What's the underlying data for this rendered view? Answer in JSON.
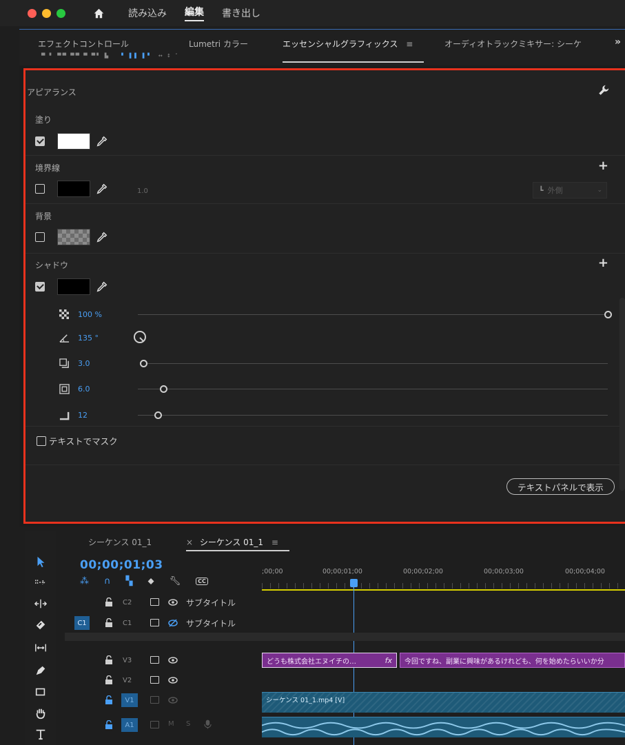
{
  "app": {
    "traffic_colors": [
      "#ff5f57",
      "#febc2e",
      "#28c840"
    ],
    "workspaces": [
      "読み込み",
      "編集",
      "書き出し"
    ],
    "active_workspace": "編集"
  },
  "panel_tabs": {
    "effect_controls": "エフェクトコントロール",
    "lumetri": "Lumetri カラー",
    "essential_graphics": "エッセンシャルグラフィックス",
    "essential_menu": "≡",
    "audio_mixer": "オーディオトラックミキサー: シーケ",
    "more": "»"
  },
  "appearance": {
    "title": "アピアランス",
    "fill": {
      "label": "塗り",
      "checked": true,
      "color": "#ffffff"
    },
    "stroke": {
      "label": "境界線",
      "checked": false,
      "color": "#000000",
      "width": "1.0",
      "position": "外側"
    },
    "background": {
      "label": "背景",
      "checked": false
    },
    "shadow": {
      "label": "シャドウ",
      "checked": true,
      "color": "#000000",
      "opacity": "100 %",
      "angle": "135 °",
      "distance": "3.0",
      "size": "6.0",
      "blur": "12"
    },
    "mask_text": "テキストでマスク",
    "show_in_text_panel": "テキストパネルで表示"
  },
  "timeline": {
    "tab_inactive": "シーケンス 01_1",
    "tab_active_close": "×",
    "tab_active": "シーケンス 01_1",
    "tab_menu": "≡",
    "timecode": "00;00;01;03",
    "ruler_labels": [
      ";00;00",
      "00;00;01;00",
      "00;00;02;00",
      "00;00;03;00",
      "00;00;04;00"
    ],
    "tracks": {
      "c2": {
        "name": "C2",
        "label": "サブタイトル"
      },
      "c1": {
        "target": "C1",
        "name": "C1",
        "label": "サブタイトル"
      },
      "v3": {
        "name": "V3"
      },
      "v2": {
        "name": "V2"
      },
      "v1": {
        "target": "V1",
        "name": "V1"
      },
      "a1": {
        "target": "A1",
        "name": "A1",
        "mute": "M",
        "solo": "S"
      }
    },
    "clips": {
      "gfx1": "どうも株式会社エヌイチの…",
      "gfx1_fx": "fx",
      "gfx2": "今回ですね、副業に興味があるけれども、何を始めたらいいか分",
      "video": "シーケンス 01_1.mp4 [V]"
    }
  }
}
